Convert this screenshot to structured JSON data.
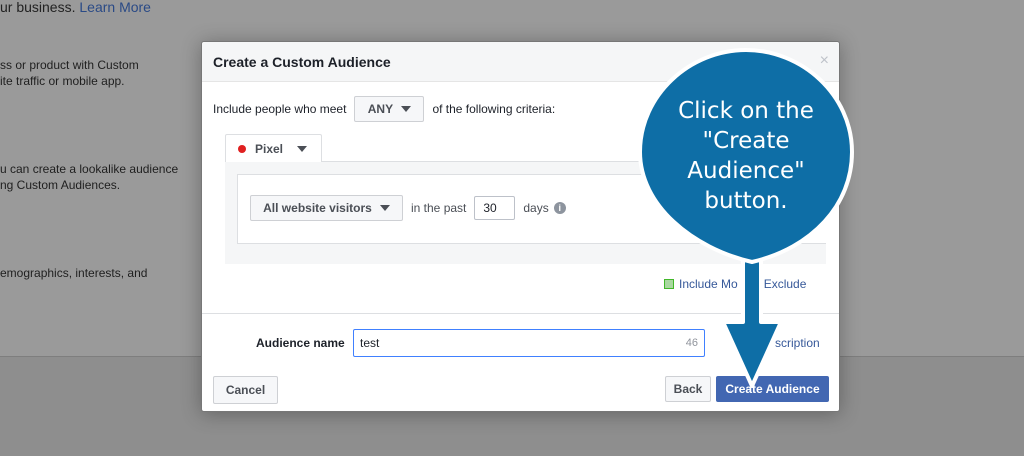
{
  "background": {
    "top_text": "ur business.",
    "top_link": "Learn More",
    "lines": [
      "ss or product with Custom",
      "ite traffic or mobile app.",
      "u can create a lookalike audience",
      "ng Custom Audiences.",
      "emographics, interests, and"
    ]
  },
  "modal": {
    "title": "Create a Custom Audience",
    "close": "×",
    "criteria": {
      "prefix": "Include people who meet",
      "mode": "ANY",
      "suffix": "of the following criteria:"
    },
    "source_tab": "Pixel",
    "rule": {
      "visitors": "All website visitors",
      "in_the_past": "in the past",
      "days_value": "30",
      "days_label": "days",
      "info": "i"
    },
    "include_more": "Include Mo",
    "exclude": "Exclude",
    "audience_name_label": "Audience name",
    "audience_name_value": "test",
    "audience_name_count": "46",
    "description_link": "scription",
    "buttons": {
      "cancel": "Cancel",
      "back": "Back",
      "create": "Create Audience"
    }
  },
  "callout": {
    "line1": "Click on the",
    "line2": "\"Create",
    "line3": "Audience\"",
    "line4": "button.",
    "color": "#0e6ea6"
  }
}
